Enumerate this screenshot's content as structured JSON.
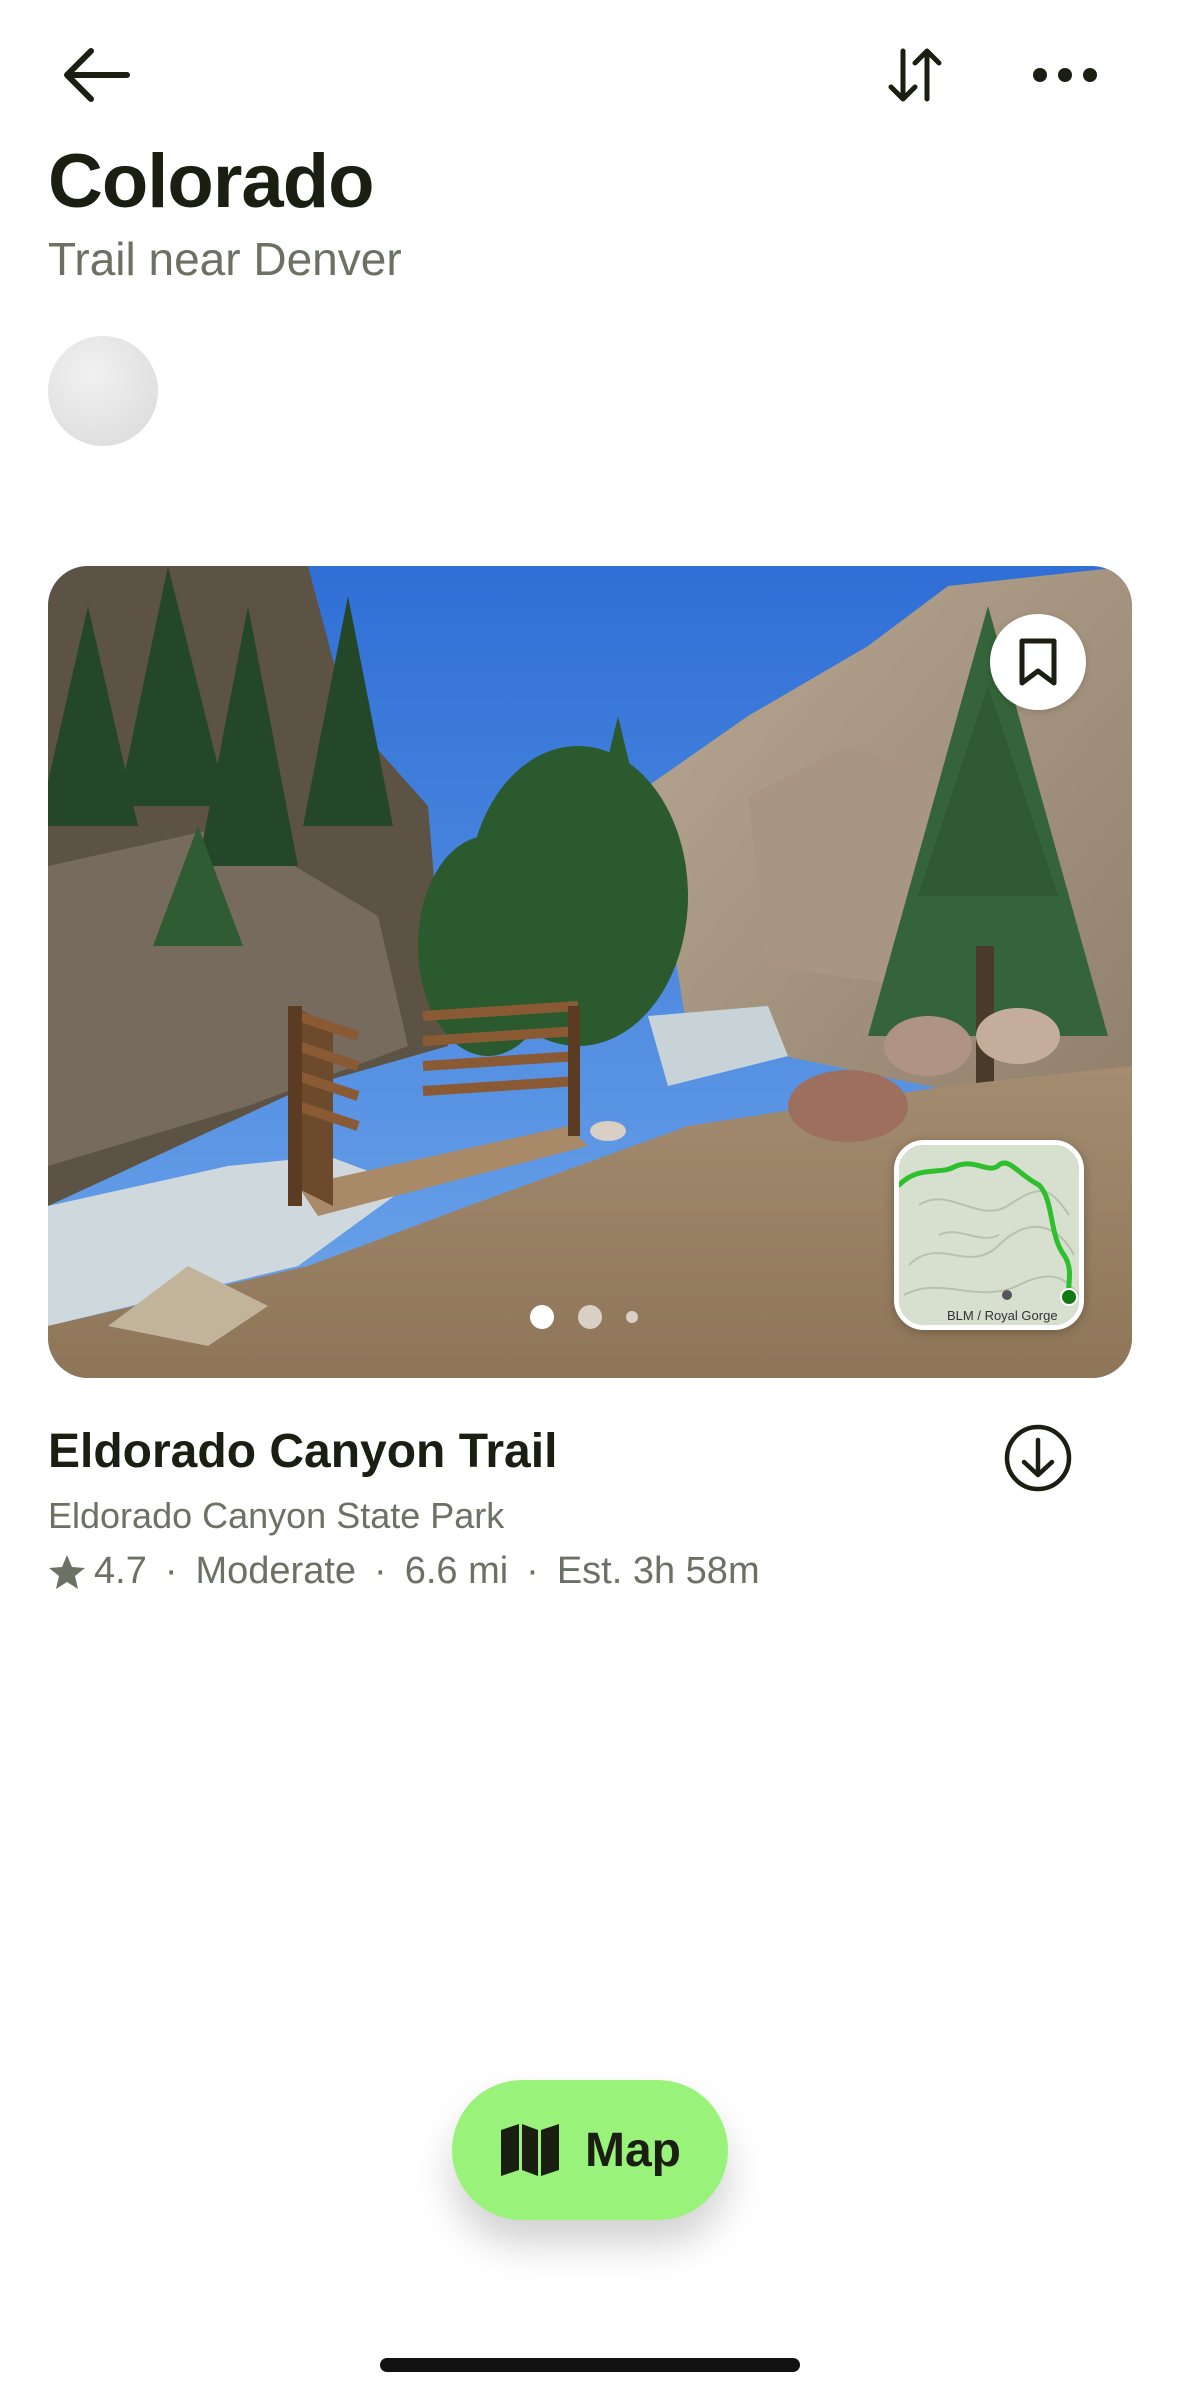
{
  "header": {
    "back_icon": "arrow-left-icon",
    "sort_icon": "sort-arrows-icon",
    "more_icon": "more-horizontal-icon"
  },
  "page": {
    "title": "Colorado",
    "subtitle": "Trail near Denver"
  },
  "trail_card": {
    "name": "Eldorado Canyon Trail",
    "park": "Eldorado Canyon State Park",
    "rating": "4.7",
    "difficulty": "Moderate",
    "length": "6.6 mi",
    "estimate": "Est. 3h 58m",
    "separator": "·",
    "map_attribution": "BLM / Royal Gorge",
    "photo_count": 3,
    "active_photo": 1,
    "bookmark_icon": "bookmark-icon",
    "download_icon": "download-circle-icon",
    "star_icon": "star-icon"
  },
  "map_button": {
    "label": "Map",
    "icon": "folded-map-icon",
    "color": "#99f37a"
  }
}
